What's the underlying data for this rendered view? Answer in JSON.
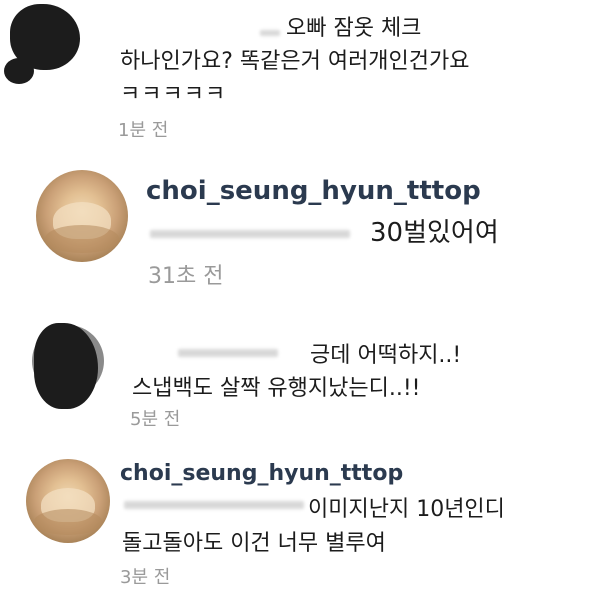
{
  "comments": [
    {
      "username": "",
      "lines": [
        "오빠 잠옷 체크",
        "하나인가요? 똑같은거 여러개인건가요",
        "ㅋㅋㅋㅋㅋ"
      ],
      "time": "1분 전"
    },
    {
      "username": "choi_seung_hyun_tttop",
      "lines": [
        "30벌있어여"
      ],
      "time": "31초 전"
    },
    {
      "username": "",
      "lines": [
        "긍데 어떡하지..!",
        "스냅백도 살짝 유행지났는디..!!"
      ],
      "time": "5분 전"
    },
    {
      "username": "choi_seung_hyun_tttop",
      "lines": [
        "이미지난지 10년인디",
        "돌고돌아도 이건 너무 별루여"
      ],
      "time": "3분 전"
    }
  ]
}
